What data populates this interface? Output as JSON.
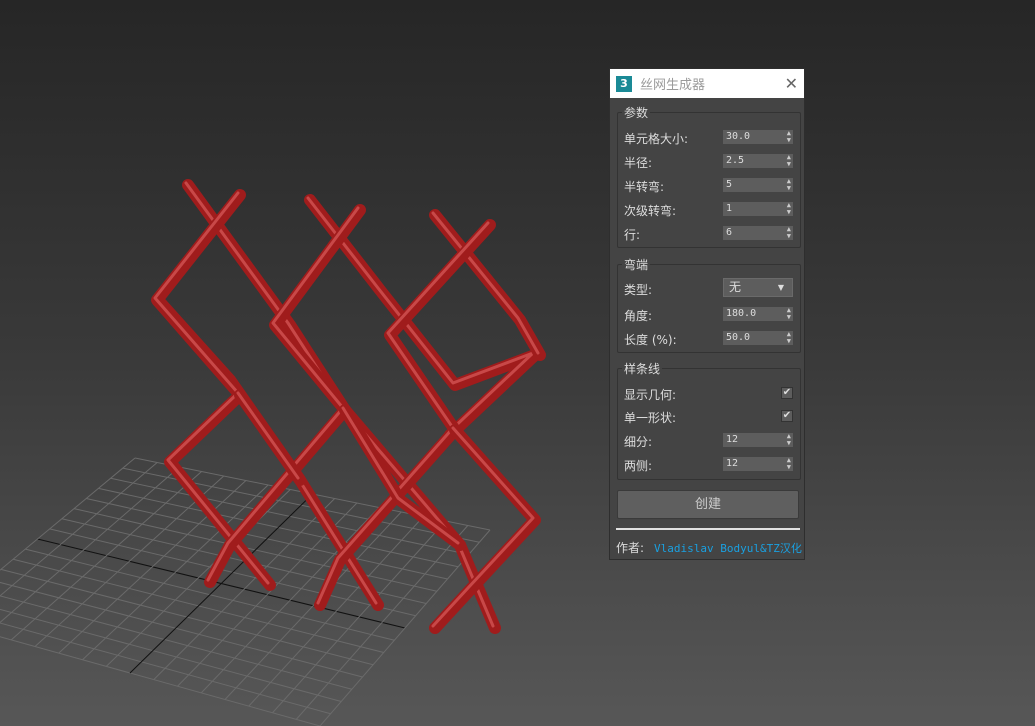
{
  "dialog": {
    "title": "丝网生成器",
    "logo": "3",
    "params": {
      "title": "参数",
      "rows": [
        {
          "label": "单元格大小:",
          "value": "30.0"
        },
        {
          "label": "半径:",
          "value": "2.5"
        },
        {
          "label": "半转弯:",
          "value": "5"
        },
        {
          "label": "次级转弯:",
          "value": "1"
        },
        {
          "label": "行:",
          "value": "6"
        }
      ]
    },
    "ends": {
      "title": "弯端",
      "type_label": "类型:",
      "type_value": "无",
      "angle_label": "角度:",
      "angle_value": "180.0",
      "length_label": "长度 (%):",
      "length_value": "50.0"
    },
    "spline": {
      "title": "样条线",
      "show_geo_label": "显示几何:",
      "show_geo": true,
      "single_label": "单一形状:",
      "single": true,
      "subdiv_label": "细分:",
      "subdiv_value": "12",
      "sides_label": "两侧:",
      "sides_value": "12"
    },
    "create_label": "创建",
    "author_label": "作者:",
    "author_value": "Vladislav Bodyul&TZ汉化"
  },
  "colors": {
    "wire": "#a01c1c",
    "accent": "#1aa0e0"
  }
}
